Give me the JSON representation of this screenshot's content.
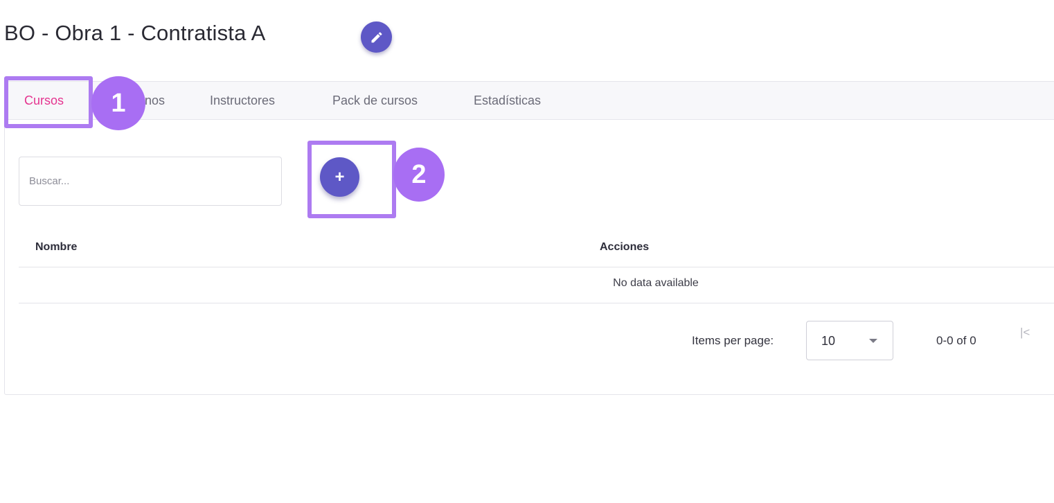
{
  "header": {
    "title": "BO - Obra 1 - Contratista A",
    "edit_icon": "pencil-icon"
  },
  "tabs": [
    {
      "label": "Cursos",
      "active": true
    },
    {
      "label": "nos",
      "active": false
    },
    {
      "label": "Instructores",
      "active": false
    },
    {
      "label": "Pack de cursos",
      "active": false
    },
    {
      "label": "Estadísticas",
      "active": false
    }
  ],
  "annotations": [
    {
      "number": "1",
      "target": "tab-cursos"
    },
    {
      "number": "2",
      "target": "add-button"
    }
  ],
  "search": {
    "placeholder": "Buscar...",
    "value": ""
  },
  "add_button": {
    "label": "+"
  },
  "table": {
    "columns": [
      "Nombre",
      "Acciones"
    ],
    "empty_text": "No data available"
  },
  "pagination": {
    "items_per_page_label": "Items per page:",
    "items_per_page_value": "10",
    "range_text": "0-0 of 0",
    "first_page_glyph": "|<"
  },
  "colors": {
    "accent_purple": "#5e58c6",
    "highlight_purple": "#ad7bf1",
    "badge_purple": "#a86ef3",
    "active_tab_pink": "#e5348f"
  }
}
